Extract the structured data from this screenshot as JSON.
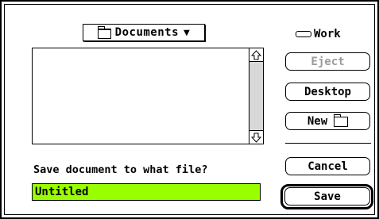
{
  "folder_popup": {
    "label": "Documents",
    "icon": "folder-icon",
    "arrow": "▼"
  },
  "file_list": {
    "items": [],
    "scroll_up_icon": "scroll-up-arrow-icon",
    "scroll_down_icon": "scroll-down-arrow-icon"
  },
  "disk": {
    "name": "Work",
    "icon": "disk-icon"
  },
  "buttons": {
    "eject": "Eject",
    "desktop": "Desktop",
    "new": "New",
    "cancel": "Cancel",
    "save": "Save"
  },
  "prompt": "Save document to what file?",
  "filename_field": {
    "value": "Untitled",
    "highlight_color": "#99ff00"
  }
}
